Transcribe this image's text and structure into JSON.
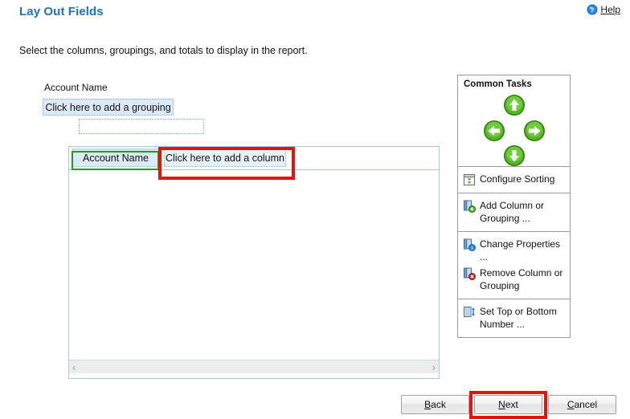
{
  "header": {
    "title": "Lay Out Fields",
    "subtitle": "Select the columns, groupings, and totals to display in the report.",
    "help_label": "Help",
    "help_icon": "help-circle-icon",
    "title_color": "#1f6fc4"
  },
  "grouping": {
    "label": "Account Name",
    "add_grouping_label": "Click here to add a grouping",
    "empty_slot_label": ""
  },
  "table": {
    "columns": [
      {
        "label": "Account Name",
        "state": "selected",
        "highlight": "green"
      },
      {
        "label": "Click here to add a column",
        "state": "placeholder",
        "highlight": "red"
      }
    ],
    "rows": [],
    "scrollbar": {
      "left_arrow": "‹",
      "right_arrow": "›"
    }
  },
  "common_tasks": {
    "title": "Common Tasks",
    "arrows": [
      {
        "name": "move-up",
        "glyph": "up"
      },
      {
        "name": "move-left",
        "glyph": "left"
      },
      {
        "name": "move-right",
        "glyph": "right"
      },
      {
        "name": "move-down",
        "glyph": "down"
      }
    ],
    "sections": [
      {
        "items": [
          {
            "label": "Configure Sorting",
            "icon": "configure-sorting-icon"
          }
        ]
      },
      {
        "items": [
          {
            "label": "Add Column or Grouping ...",
            "icon": "add-column-icon"
          }
        ]
      },
      {
        "items": [
          {
            "label": "Change Properties ...",
            "icon": "change-properties-icon"
          },
          {
            "label": "Remove Column or Grouping",
            "icon": "remove-column-icon"
          }
        ]
      },
      {
        "items": [
          {
            "label": "Set Top or Bottom Number ...",
            "icon": "set-top-bottom-icon"
          }
        ]
      }
    ]
  },
  "footer": {
    "back": {
      "text": "Back",
      "accel": "B",
      "before": "",
      "after": "ack"
    },
    "next": {
      "text": "Next",
      "accel": "N",
      "before": "",
      "after": "ext",
      "highlight": "red"
    },
    "cancel": {
      "text": "Cancel",
      "accel": "C",
      "before": "",
      "after": "ancel"
    }
  },
  "colors": {
    "title_blue": "#1f6fc4",
    "highlight_red": "#e8120c",
    "highlight_green": "#19a319",
    "panel_border_blue": "#a8c6e6",
    "cell_fill_blue": "#dce9f7",
    "arrow_green": "#3ba514"
  }
}
